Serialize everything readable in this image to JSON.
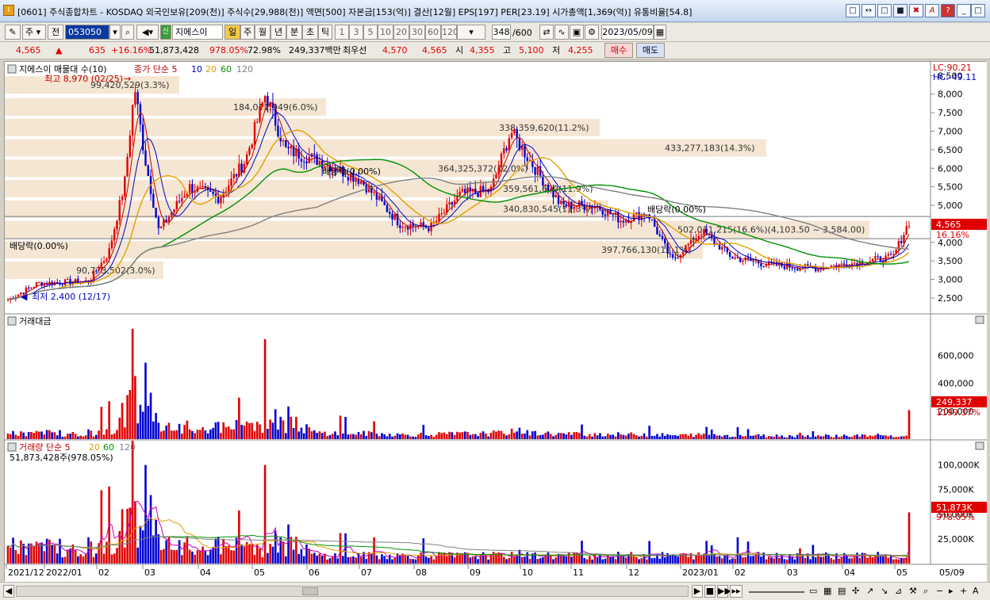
{
  "window": {
    "title": "[0601] 주식종합차트 - KOSDAQ 외국인보유[209(천)] 주식수[29,988(천)] 액면[500] 자본금[153(억)] 결산[12월] EPS[197] PER[23.19] 시가총액[1,369(억)] 유통비율[54.8]",
    "icon": "chart-app-icon",
    "buttons": [
      "□",
      "↔",
      "□",
      "■",
      "✖",
      "A",
      "?",
      "_",
      "□",
      "✕"
    ]
  },
  "toolbar": {
    "market": "주",
    "all": "전",
    "code": "053050",
    "stock_name": "지에스이",
    "periods": [
      "일",
      "주",
      "월",
      "년",
      "분",
      "초",
      "틱"
    ],
    "active_period": "일",
    "intervals": [
      "1",
      "3",
      "5",
      "10",
      "20",
      "30",
      "60",
      "120"
    ],
    "count": "348",
    "count_max": "/600",
    "date": "2023/05/09"
  },
  "quote": {
    "price": "4,565",
    "change": "635",
    "change_pct": "+16.16%",
    "volume": "51,873,428",
    "volume_ratio": "978.05%",
    "turnover": "72.98%",
    "amount": "249,337백만",
    "priority_label": "최우선",
    "ask": "4,570",
    "bid": "4,565",
    "open_label": "시",
    "open": "4,355",
    "high_label": "고",
    "high": "5,100",
    "low_label": "저",
    "low": "4,255",
    "buy_button": "매수",
    "sell_button": "매도"
  },
  "price_pane": {
    "legend_name": "지에스이 매물대 수(10)",
    "legend_ma": "종가 단순 5",
    "ma_periods": [
      "10",
      "20",
      "60",
      "120"
    ],
    "ma_colors": [
      "#c00000",
      "#0000c0",
      "#e0a000",
      "#009000",
      "#808080"
    ],
    "lc": "LC:90.21",
    "hc": "HC:-49.11",
    "y_ticks": [
      "8,500",
      "8,000",
      "7,500",
      "7,000",
      "6,500",
      "6,000",
      "5,500",
      "5,000",
      "4,500",
      "4,000",
      "3,500",
      "3,000",
      "2,500"
    ],
    "current_price": "4,565",
    "current_change": "16.16%",
    "high_note": "최고 8,970 (02/25)",
    "low_note": "최저 2,400 (12/17)",
    "volume_profile": [
      {
        "label": "99,420,529(3.3%)"
      },
      {
        "label": "184,011,949(6.0%)"
      },
      {
        "label": "338,359,620(11.2%)"
      },
      {
        "label": "433,277,183(14.3%)"
      },
      {
        "label": "364,325,372(12.0%)"
      },
      {
        "label": "359,561,600(11.9%)"
      },
      {
        "label": "340,830,545(11.3%)"
      },
      {
        "label": "502,011,215(16.6%)(4,103.50 ~ 3,584.00)"
      },
      {
        "label": "397,766,130(13.1%)"
      },
      {
        "label": "90,773,502(3.0%)"
      }
    ],
    "dividend_notes": [
      "배당락(0.00%)",
      "배당락(0.00%)",
      "배당락(0.00%)"
    ]
  },
  "amount_pane": {
    "title": "거래대금",
    "y_ticks": [
      "600,000",
      "400,000",
      "200,000"
    ],
    "current_value": "249,337",
    "current_ratio": "1199.37%"
  },
  "volume_pane": {
    "title": "거래량 단순 5",
    "ma_periods": [
      "20",
      "60",
      "120"
    ],
    "subtitle": "51,873,428주(978.05%)",
    "y_ticks": [
      "100,000K",
      "75,000K",
      "50,000K",
      "25,000K"
    ],
    "current_value": "51,873K",
    "current_ratio": "978.05%"
  },
  "x_axis": [
    "2021/12",
    "2022/01",
    "02",
    "03",
    "04",
    "05",
    "06",
    "07",
    "08",
    "09",
    "10",
    "11",
    "12",
    "2023/01",
    "02",
    "03",
    "04",
    "05",
    "05/09"
  ],
  "colors": {
    "up": "#e00000",
    "down": "#0000d0",
    "profile": "#f5e6d3"
  }
}
